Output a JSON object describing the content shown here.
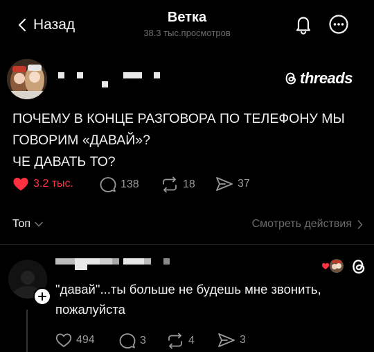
{
  "header": {
    "back_label": "Назад",
    "title": "Ветка",
    "views": "38.3 тыс.просмотров"
  },
  "post": {
    "brand": "threads",
    "text_lines": [
      "ПОЧЕМУ В КОНЦЕ РАЗГОВОРА ПО ТЕЛЕФОНУ МЫ",
      "ГОВОРИМ «ДАВАЙ»?",
      "ЧЕ ДАВАТЬ ТО?"
    ],
    "likes": "3.2 тыс.",
    "replies": "138",
    "reposts": "18",
    "shares": "37",
    "liked": true
  },
  "sort": {
    "label": "Топ",
    "activity_label": "Смотреть действия"
  },
  "reply": {
    "text_lines": [
      "\"давай\"...ты больше не будешь мне звонить,",
      "пожалуйста"
    ],
    "likes": "494",
    "replies": "3",
    "reposts": "4",
    "shares": "3"
  },
  "icons": {
    "back": "chevron-left-icon",
    "bell": "bell-icon",
    "more": "more-circle-icon",
    "brand": "threads-logo-icon",
    "like": "heart-icon",
    "reply": "comment-bubble-icon",
    "repost": "repost-icon",
    "share": "send-icon"
  },
  "colors": {
    "background": "#000000",
    "like_red": "#ff3040",
    "muted": "#6b6b6b"
  }
}
